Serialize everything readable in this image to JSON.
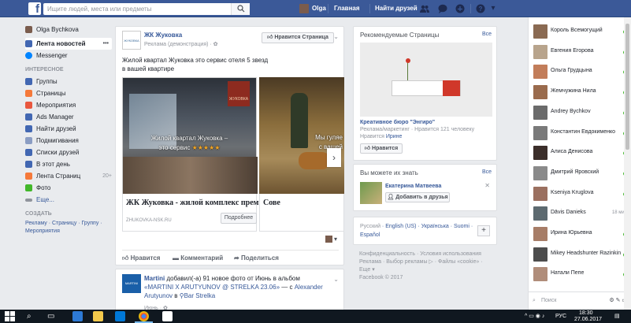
{
  "topbar": {
    "logo": "f",
    "search_placeholder": "Ищите людей, места или предметы",
    "search_icon": "magnifier-icon",
    "user_name": "Olga",
    "home": "Главная",
    "find_friends": "Найти друзей",
    "icons": [
      "friend-requests-icon",
      "messages-icon",
      "notifications-icon",
      "help-icon",
      "caret-down-icon"
    ]
  },
  "leftnav": {
    "user": "Olga Bychkova",
    "items": [
      {
        "label": "Лента новостей",
        "icon": "news-feed-icon",
        "color": "#4267b2",
        "active": true,
        "more": "•••"
      },
      {
        "label": "Messenger",
        "icon": "messenger-icon",
        "color": "#0084ff"
      }
    ],
    "interests_head": "ИНТЕРЕСНОЕ",
    "interests": [
      {
        "label": "Группы",
        "icon": "groups-icon",
        "color": "#4267b2"
      },
      {
        "label": "Страницы",
        "icon": "pages-icon",
        "color": "#f5793a"
      },
      {
        "label": "Мероприятия",
        "icon": "events-icon",
        "color": "#e9573f"
      },
      {
        "label": "Ads Manager",
        "icon": "ads-manager-icon",
        "color": "#4267b2"
      },
      {
        "label": "Найти друзей",
        "icon": "find-friends-icon",
        "color": "#4267b2"
      },
      {
        "label": "Подмигивания",
        "icon": "pokes-icon",
        "color": "#8b9dc3"
      },
      {
        "label": "Списки друзей",
        "icon": "friend-lists-icon",
        "color": "#4267b2"
      },
      {
        "label": "В этот день",
        "icon": "on-this-day-icon",
        "color": "#4267b2"
      },
      {
        "label": "Лента Страниц",
        "icon": "pages-feed-icon",
        "color": "#f5793a",
        "count": "20+"
      },
      {
        "label": "Фото",
        "icon": "photos-icon",
        "color": "#42b72a"
      },
      {
        "label": "Еще...",
        "icon": "more-icon",
        "color": "#90949c"
      }
    ],
    "create_head": "СОЗДАТЬ",
    "create_links": "Рекламу · Страницу · Группу · Мероприятия"
  },
  "post1": {
    "logo": "ЖУКОВКА",
    "page_name": "ЖК Жуковка",
    "subtitle": "Реклама (демонстрация) · ✿",
    "like_button": "Нравится Страница",
    "text_line1": "Жилой квартал Жуковка это сервис отеля 5 звезд",
    "text_line2": "в вашей квартире",
    "slide1_logo": "ЖУКОВКА",
    "slide1_caption1": "Жилой квартал Жуковка –",
    "slide1_caption2": "это сервис",
    "stars": "★★★★★",
    "slide2_caption1": "Мы гуляе",
    "slide2_caption2": "с вашей",
    "next": "›",
    "link_title": "ЖК Жуковка - жилой комплекс премиум класса.",
    "link_url": "ZHUKOVKA-NSK.RU",
    "more_button": "Подробнее",
    "link2_title": "Сове",
    "share_ctrl": "▾",
    "like": "Нравится",
    "comment": "Комментарий",
    "share": "Поделиться"
  },
  "post2": {
    "logo": "MARTINI",
    "name": "Martini",
    "text1": " добавил(-а) 91 новое фото от Июнь в альбом",
    "album": "«MARTINI X ARUTYUNOV @ STRELKA 23.06»",
    "text2": " — с ",
    "person": "Alexander Arutyunov",
    "text3": " в ",
    "place": "Bar Strelka",
    "time": "Июнь · ✿"
  },
  "right": {
    "rec_head": "Рекомендуемые Страницы",
    "rec_all": "Все",
    "rec_name": "Креативное бюро \"Энгиро\"",
    "rec_sub": "Реклама/маркетинг · Нравится 121 человеку",
    "rec_sub2_prefix": "Нравится ",
    "rec_sub2_name": "Ирине",
    "rec_like": "Нравится",
    "pymk_head": "Вы можете их знать",
    "pymk_all": "Все",
    "pymk_name": "Екатерина Матвеева",
    "pymk_add": "Добавить в друзья",
    "pymk_close": "✕",
    "lang_current": "Русский",
    "languages": [
      "English (US)",
      "Українська",
      "Suomi",
      "Español"
    ],
    "lang_plus": "+",
    "footer_line1": "Конфиденциальность · Условия использования",
    "footer_line2": "Реклама · Выбор рекламы ▷ · Файлы «cookie» ·",
    "footer_line3": "Еще ▾",
    "footer_line4": "Facebook © 2017"
  },
  "chat": {
    "contacts": [
      {
        "name": "Король Всемогущий",
        "color": "#8a6a52",
        "status": "online"
      },
      {
        "name": "Евгения Егорова",
        "color": "#b8a48c",
        "status": "online"
      },
      {
        "name": "Ольга Грудцына",
        "color": "#c27d5a",
        "status": "online"
      },
      {
        "name": "Жемчужина Нила",
        "color": "#9a6b4d",
        "status": "online"
      },
      {
        "name": "Andrey Bychkov",
        "color": "#6b6b6b",
        "status": "online"
      },
      {
        "name": "Константин Евдокименко",
        "color": "#7a7a7a",
        "status": "online"
      },
      {
        "name": "Алиса Денисова",
        "color": "#3b2e2a",
        "status": "online"
      },
      {
        "name": "Дмитрий Яровский",
        "color": "#8a8a8a",
        "status": "online"
      },
      {
        "name": "Kseniya Kruglova",
        "color": "#9b7060",
        "status": "online"
      },
      {
        "name": "Dāvis Danieks",
        "color": "#5d6a70",
        "time": "18 мин"
      },
      {
        "name": "Ирина Юрьевна",
        "color": "#a77d67",
        "status": "online"
      },
      {
        "name": "Mikey Headshunter Razinkin",
        "color": "#4d4d4d",
        "status": "online"
      },
      {
        "name": "Натали Пепе",
        "color": "#b08d7a",
        "status": "online"
      }
    ],
    "search": "Поиск",
    "tools": "⚙ ✎ ▭"
  },
  "taskbar": {
    "lang": "РУС",
    "time": "18:30",
    "date": "27.06.2017",
    "tray": "^ ▭ ◉ ♪"
  }
}
